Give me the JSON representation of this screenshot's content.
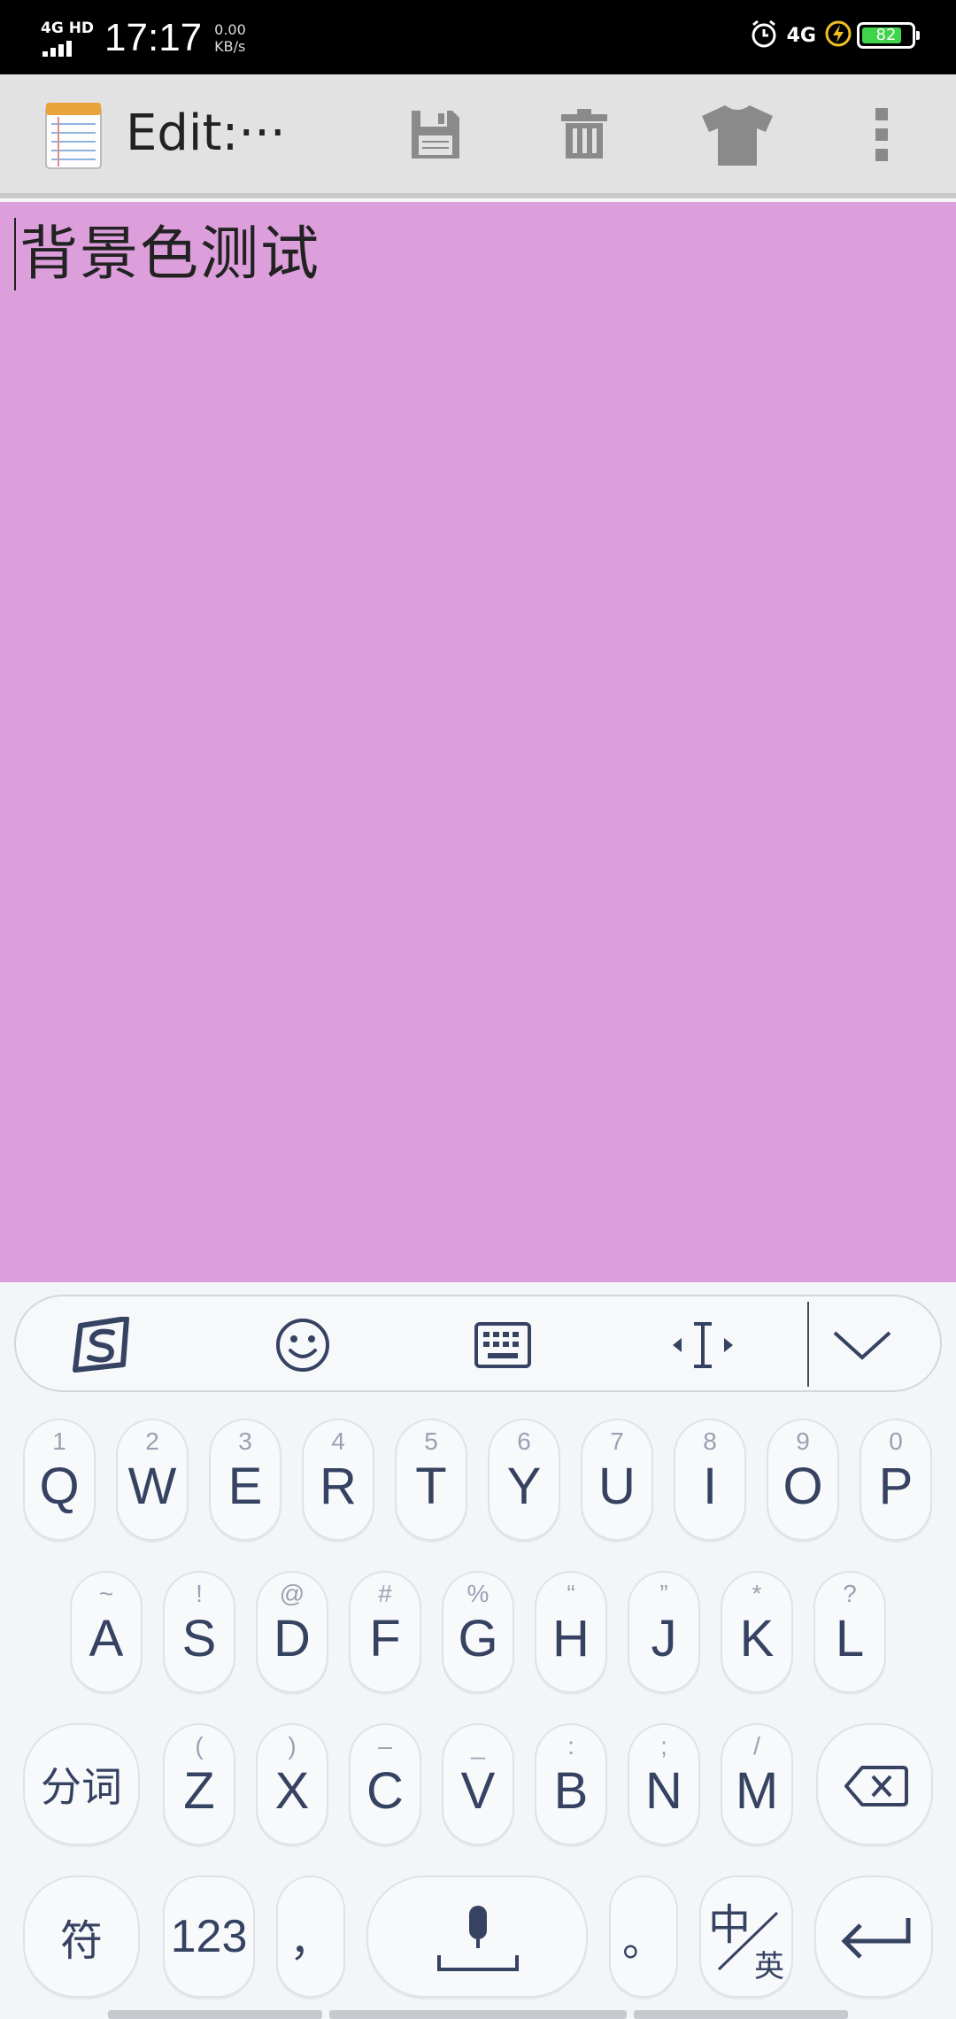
{
  "status_bar": {
    "network_label": "4G HD",
    "time": "17:17",
    "speed_value": "0.00",
    "speed_unit": "KB/s",
    "network_type": "4G",
    "battery_level": "82",
    "icons": [
      "signal-icon",
      "alarm-icon",
      "charging-icon",
      "battery-icon"
    ]
  },
  "toolbar": {
    "title": "Edit:···",
    "actions": [
      {
        "name": "save-icon",
        "label": "Save"
      },
      {
        "name": "delete-icon",
        "label": "Delete"
      },
      {
        "name": "theme-icon",
        "label": "Background color"
      },
      {
        "name": "more-icon",
        "label": "More"
      }
    ]
  },
  "editor": {
    "text": "背景色测试",
    "background_color": "#dc9fdb"
  },
  "keyboard": {
    "toolbar_icons": [
      "sogou-logo-icon",
      "emoji-icon",
      "keyboard-icon",
      "cursor-icon",
      "collapse-icon"
    ],
    "row1": [
      {
        "hint": "1",
        "label": "Q"
      },
      {
        "hint": "2",
        "label": "W"
      },
      {
        "hint": "3",
        "label": "E"
      },
      {
        "hint": "4",
        "label": "R"
      },
      {
        "hint": "5",
        "label": "T"
      },
      {
        "hint": "6",
        "label": "Y"
      },
      {
        "hint": "7",
        "label": "U"
      },
      {
        "hint": "8",
        "label": "I"
      },
      {
        "hint": "9",
        "label": "O"
      },
      {
        "hint": "0",
        "label": "P"
      }
    ],
    "row2": [
      {
        "hint": "~",
        "label": "A"
      },
      {
        "hint": "!",
        "label": "S"
      },
      {
        "hint": "@",
        "label": "D"
      },
      {
        "hint": "#",
        "label": "F"
      },
      {
        "hint": "%",
        "label": "G"
      },
      {
        "hint": "“",
        "label": "H"
      },
      {
        "hint": "”",
        "label": "J"
      },
      {
        "hint": "*",
        "label": "K"
      },
      {
        "hint": "?",
        "label": "L"
      }
    ],
    "row3_left": "分词",
    "row3": [
      {
        "hint": "(",
        "label": "Z"
      },
      {
        "hint": ")",
        "label": "X"
      },
      {
        "hint": "–",
        "label": "C"
      },
      {
        "hint": "_",
        "label": "V"
      },
      {
        "hint": ":",
        "label": "B"
      },
      {
        "hint": ";",
        "label": "N"
      },
      {
        "hint": "/",
        "label": "M"
      }
    ],
    "row4": {
      "symbols": "符",
      "numbers": "123",
      "comma": "，",
      "period": "。",
      "lang_top": "中",
      "lang_bottom": "英"
    },
    "accent_color": "#364262"
  }
}
